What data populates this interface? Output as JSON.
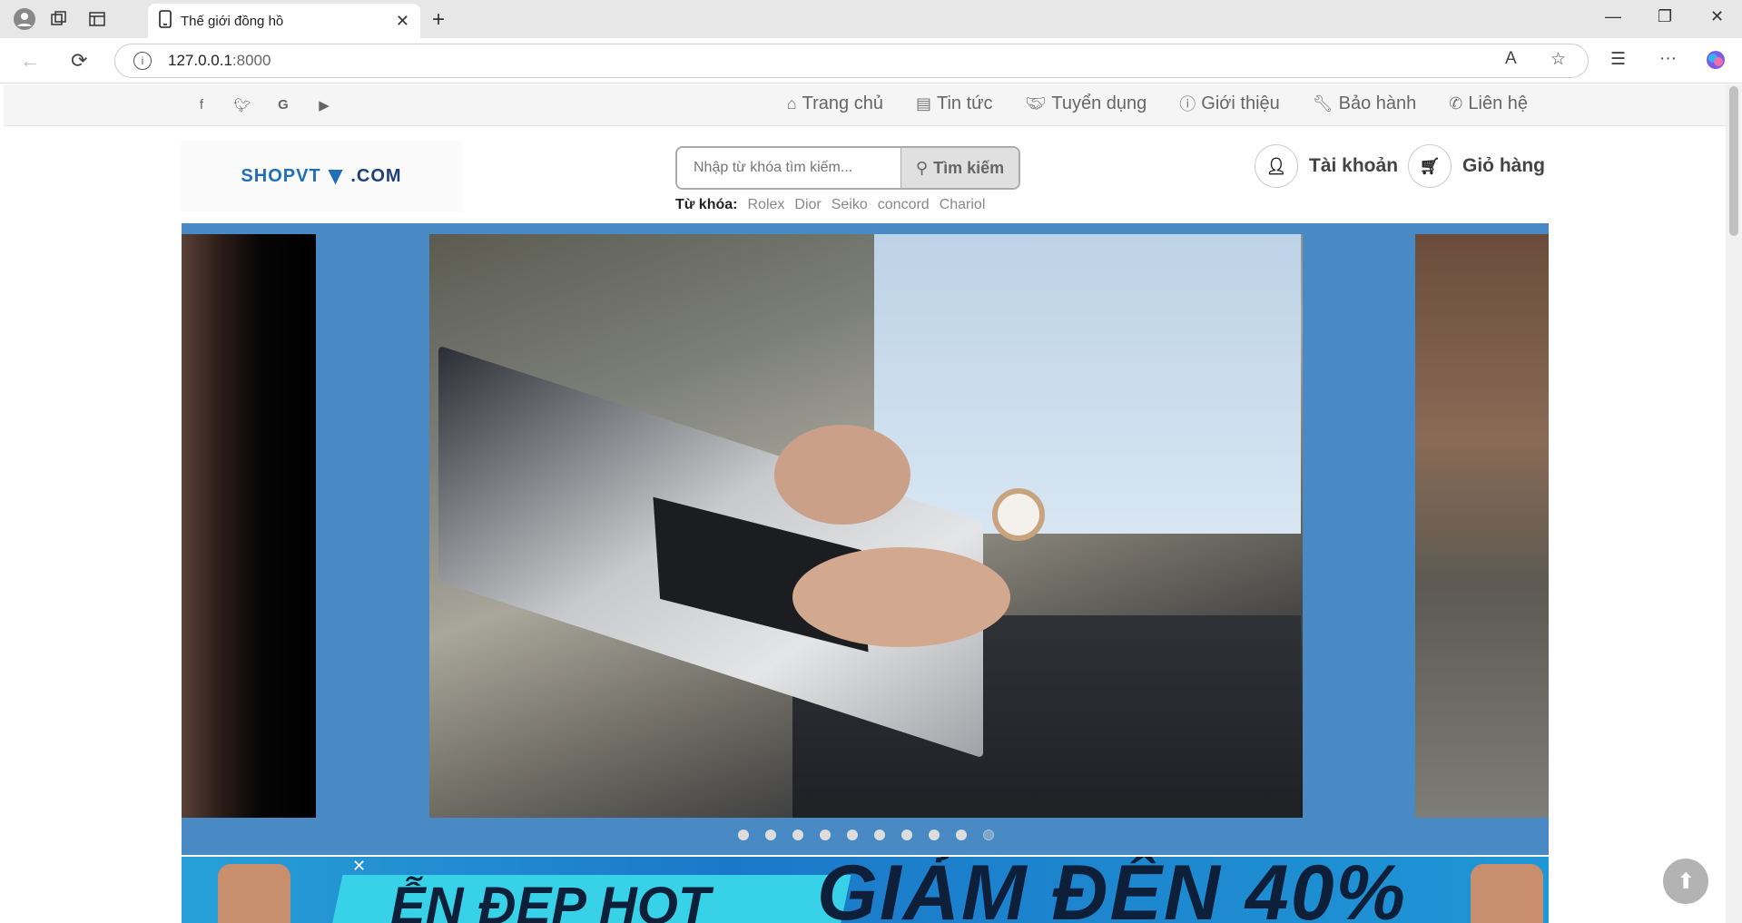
{
  "browser": {
    "tab_title": "Thế giới đồng hồ",
    "url_host": "127.0.0.1",
    "url_port": ":8000"
  },
  "site": {
    "social": [
      "f",
      "t",
      "G",
      "yt"
    ],
    "nav": [
      {
        "icon": "home-icon",
        "label": "Trang chủ"
      },
      {
        "icon": "newspaper-icon",
        "label": "Tin tức"
      },
      {
        "icon": "handshake-icon",
        "label": "Tuyển dụng"
      },
      {
        "icon": "info-icon",
        "label": "Giới thiệu"
      },
      {
        "icon": "wrench-icon",
        "label": "Bảo hành"
      },
      {
        "icon": "phone-icon",
        "label": "Liên hệ"
      }
    ],
    "logo": {
      "shop": "SHOPVT",
      "com": ".COM"
    },
    "search": {
      "placeholder": "Nhập từ khóa tìm kiếm...",
      "button_label": "Tìm kiếm"
    },
    "keywords": {
      "label": "Từ khóa:",
      "items": [
        "Rolex",
        "Dior",
        "Seiko",
        "concord",
        "Chariol"
      ]
    },
    "account_label": "Tài khoản",
    "cart_label": "Giỏ hàng",
    "slider": {
      "dot_count": 10,
      "active_index": 9
    },
    "banner": {
      "left_text": "ỄN ĐẸP HOT",
      "right_text": "GIẢM ĐẾN 40%"
    }
  }
}
